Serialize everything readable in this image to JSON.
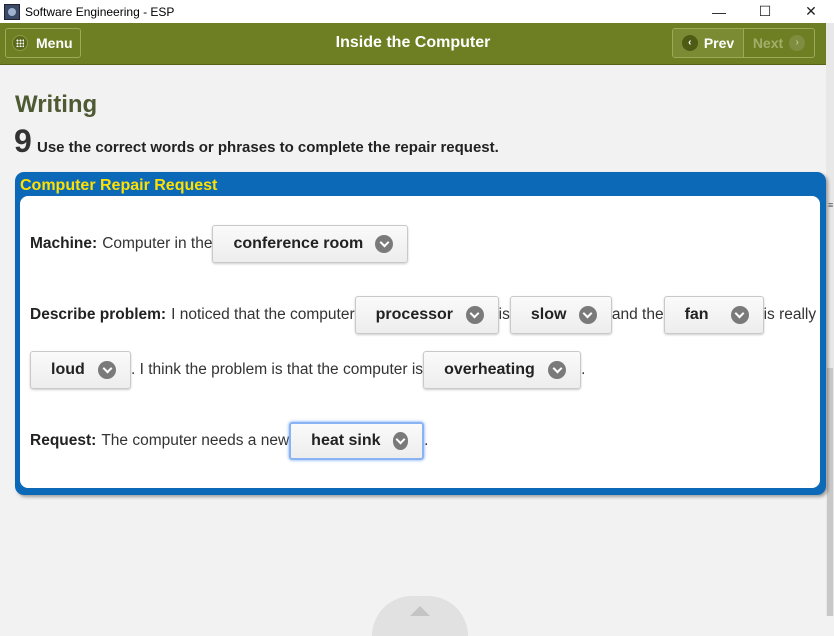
{
  "window": {
    "title": "Software Engineering - ESP",
    "controls": {
      "minimize": "—",
      "maximize": "☐",
      "close": "✕"
    }
  },
  "appbar": {
    "menu_label": "Menu",
    "title": "Inside the Computer",
    "prev_label": "Prev",
    "next_label": "Next",
    "prev_icon": "‹",
    "next_icon": "›"
  },
  "content": {
    "section_title": "Writing",
    "exercise_number": "9",
    "instruction": "Use the correct words or phrases to complete the repair request."
  },
  "form": {
    "title": "Computer Repair Request",
    "machine": {
      "label": "Machine:",
      "text1": "Computer in the",
      "choice1": "conference room"
    },
    "problem": {
      "label": "Describe problem:",
      "text1": "I noticed that the computer",
      "choice1": "processor",
      "text2": "is",
      "choice2": "slow",
      "text3": "and the",
      "choice3": "fan",
      "text4": "is really",
      "choice4": "loud",
      "text5": ". I think the problem is that the computer is",
      "choice5": "overheating",
      "text6": "."
    },
    "request": {
      "label": "Request:",
      "text1": "The computer needs a new",
      "choice1": "heat sink",
      "text2": "."
    }
  },
  "colors": {
    "appbar": "#6d7e23",
    "panel_border": "#0b69b7",
    "panel_title": "#ffe000",
    "section_title": "#4d5a33",
    "focus_ring": "#8ab3f5"
  }
}
